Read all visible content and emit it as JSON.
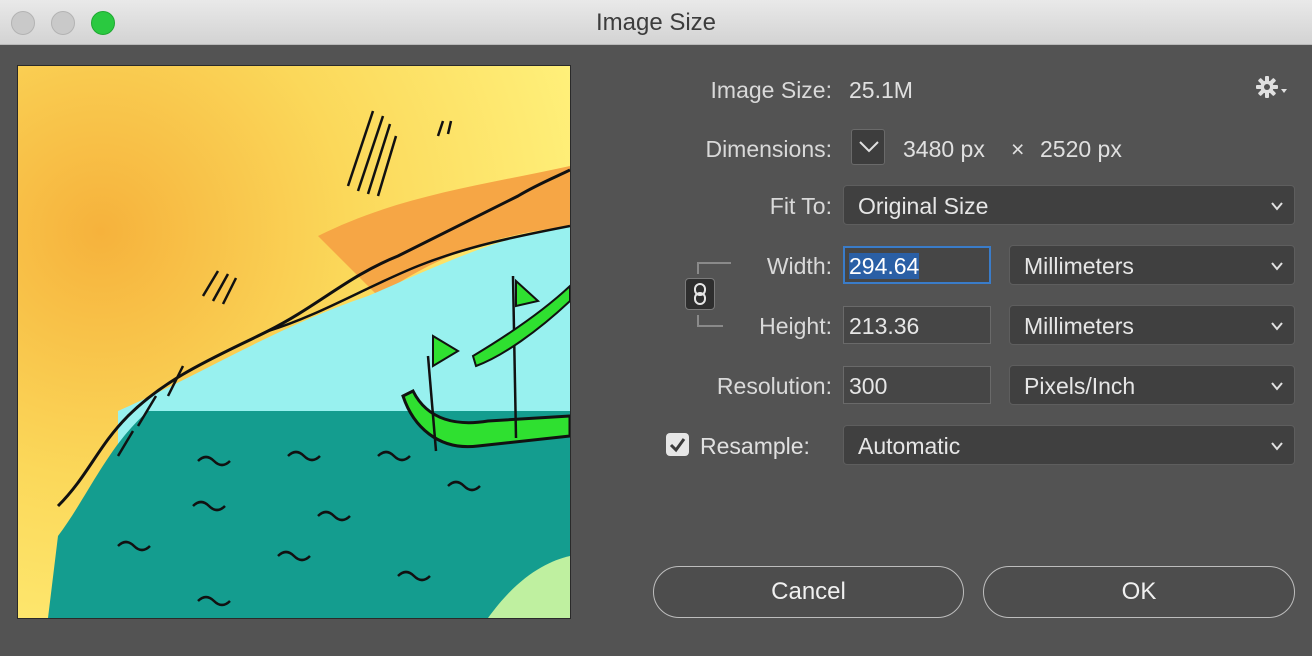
{
  "window": {
    "title": "Image Size"
  },
  "info": {
    "image_size_label": "Image Size:",
    "image_size_value": "25.1M",
    "dimensions_label": "Dimensions:",
    "dimensions_width": "3480 px",
    "dimensions_sep": "×",
    "dimensions_height": "2520 px"
  },
  "fit_to": {
    "label": "Fit To:",
    "value": "Original Size"
  },
  "width": {
    "label": "Width:",
    "value": "294.64",
    "unit": "Millimeters"
  },
  "height": {
    "label": "Height:",
    "value": "213.36",
    "unit": "Millimeters"
  },
  "resolution": {
    "label": "Resolution:",
    "value": "300",
    "unit": "Pixels/Inch"
  },
  "resample": {
    "label": "Resample:",
    "checked": true,
    "value": "Automatic"
  },
  "buttons": {
    "cancel": "Cancel",
    "ok": "OK"
  },
  "icons": {
    "settings": "gear-icon",
    "link": "chain-link-icon",
    "dimensions_toggle": "chevron-down-icon",
    "dropdown": "chevron-down-icon",
    "check": "checkmark-icon"
  },
  "colors": {
    "dialog_bg": "#535353",
    "focus_ring": "#3a7cc9",
    "selection": "#2a5fa5",
    "zoom_green": "#2ac940"
  }
}
